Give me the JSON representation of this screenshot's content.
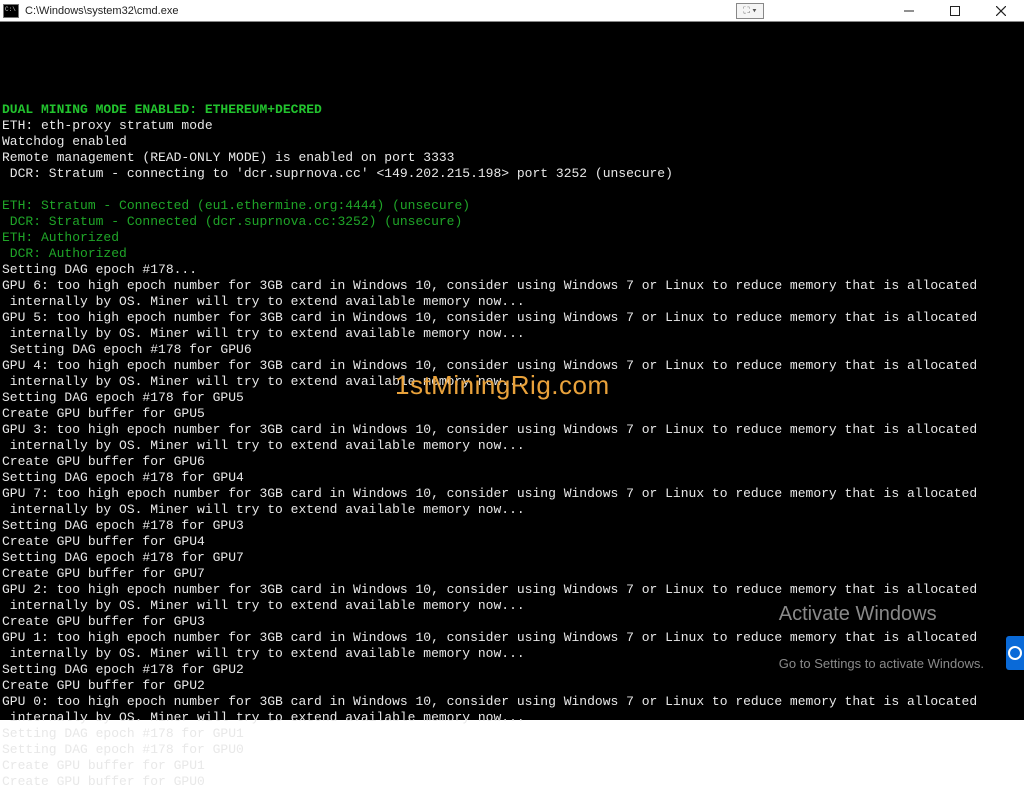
{
  "window": {
    "title": "C:\\Windows\\system32\\cmd.exe",
    "pip_label": "⛶ ▾"
  },
  "lines": [
    {
      "cls": "c-green-bright",
      "text": "DUAL MINING MODE ENABLED: ETHEREUM+DECRED"
    },
    {
      "cls": "c-white",
      "text": "ETH: eth-proxy stratum mode"
    },
    {
      "cls": "c-white",
      "text": "Watchdog enabled"
    },
    {
      "cls": "c-white",
      "text": "Remote management (READ-ONLY MODE) is enabled on port 3333"
    },
    {
      "cls": "c-white",
      "text": " DCR: Stratum - connecting to 'dcr.suprnova.cc' <149.202.215.198> port 3252 (unsecure)"
    },
    {
      "cls": "c-white",
      "text": ""
    },
    {
      "cls": "c-green",
      "text": "ETH: Stratum - Connected (eu1.ethermine.org:4444) (unsecure)"
    },
    {
      "cls": "c-green",
      "text": " DCR: Stratum - Connected (dcr.suprnova.cc:3252) (unsecure)"
    },
    {
      "cls": "c-green",
      "text": "ETH: Authorized"
    },
    {
      "cls": "c-green",
      "text": " DCR: Authorized"
    },
    {
      "cls": "c-white",
      "text": "Setting DAG epoch #178..."
    },
    {
      "cls": "c-white",
      "text": "GPU 6: too high epoch number for 3GB card in Windows 10, consider using Windows 7 or Linux to reduce memory that is allocated"
    },
    {
      "cls": "c-white",
      "text": " internally by OS. Miner will try to extend available memory now..."
    },
    {
      "cls": "c-white",
      "text": "GPU 5: too high epoch number for 3GB card in Windows 10, consider using Windows 7 or Linux to reduce memory that is allocated"
    },
    {
      "cls": "c-white",
      "text": " internally by OS. Miner will try to extend available memory now..."
    },
    {
      "cls": "c-white",
      "text": " Setting DAG epoch #178 for GPU6"
    },
    {
      "cls": "c-white",
      "text": "GPU 4: too high epoch number for 3GB card in Windows 10, consider using Windows 7 or Linux to reduce memory that is allocated"
    },
    {
      "cls": "c-white",
      "text": " internally by OS. Miner will try to extend available memory now..."
    },
    {
      "cls": "c-white",
      "text": "Setting DAG epoch #178 for GPU5"
    },
    {
      "cls": "c-white",
      "text": "Create GPU buffer for GPU5"
    },
    {
      "cls": "c-white",
      "text": "GPU 3: too high epoch number for 3GB card in Windows 10, consider using Windows 7 or Linux to reduce memory that is allocated"
    },
    {
      "cls": "c-white",
      "text": " internally by OS. Miner will try to extend available memory now..."
    },
    {
      "cls": "c-white",
      "text": "Create GPU buffer for GPU6"
    },
    {
      "cls": "c-white",
      "text": "Setting DAG epoch #178 for GPU4"
    },
    {
      "cls": "c-white",
      "text": "GPU 7: too high epoch number for 3GB card in Windows 10, consider using Windows 7 or Linux to reduce memory that is allocated"
    },
    {
      "cls": "c-white",
      "text": " internally by OS. Miner will try to extend available memory now..."
    },
    {
      "cls": "c-white",
      "text": "Setting DAG epoch #178 for GPU3"
    },
    {
      "cls": "c-white",
      "text": "Create GPU buffer for GPU4"
    },
    {
      "cls": "c-white",
      "text": "Setting DAG epoch #178 for GPU7"
    },
    {
      "cls": "c-white",
      "text": "Create GPU buffer for GPU7"
    },
    {
      "cls": "c-white",
      "text": "GPU 2: too high epoch number for 3GB card in Windows 10, consider using Windows 7 or Linux to reduce memory that is allocated"
    },
    {
      "cls": "c-white",
      "text": " internally by OS. Miner will try to extend available memory now..."
    },
    {
      "cls": "c-white",
      "text": "Create GPU buffer for GPU3"
    },
    {
      "cls": "c-white",
      "text": "GPU 1: too high epoch number for 3GB card in Windows 10, consider using Windows 7 or Linux to reduce memory that is allocated"
    },
    {
      "cls": "c-white",
      "text": " internally by OS. Miner will try to extend available memory now..."
    },
    {
      "cls": "c-white",
      "text": "Setting DAG epoch #178 for GPU2"
    },
    {
      "cls": "c-white",
      "text": "Create GPU buffer for GPU2"
    },
    {
      "cls": "c-white",
      "text": "GPU 0: too high epoch number for 3GB card in Windows 10, consider using Windows 7 or Linux to reduce memory that is allocated"
    },
    {
      "cls": "c-white",
      "text": " internally by OS. Miner will try to extend available memory now..."
    },
    {
      "cls": "c-white",
      "text": "Setting DAG epoch #178 for GPU1"
    },
    {
      "cls": "c-white",
      "text": "Setting DAG epoch #178 for GPU0"
    },
    {
      "cls": "c-white",
      "text": "Create GPU buffer for GPU1"
    },
    {
      "cls": "c-white",
      "text": "Create GPU buffer for GPU0"
    }
  ],
  "watermark": "1stMiningRig.com",
  "activate": {
    "line1": "Activate Windows",
    "line2": "Go to Settings to activate Windows."
  }
}
